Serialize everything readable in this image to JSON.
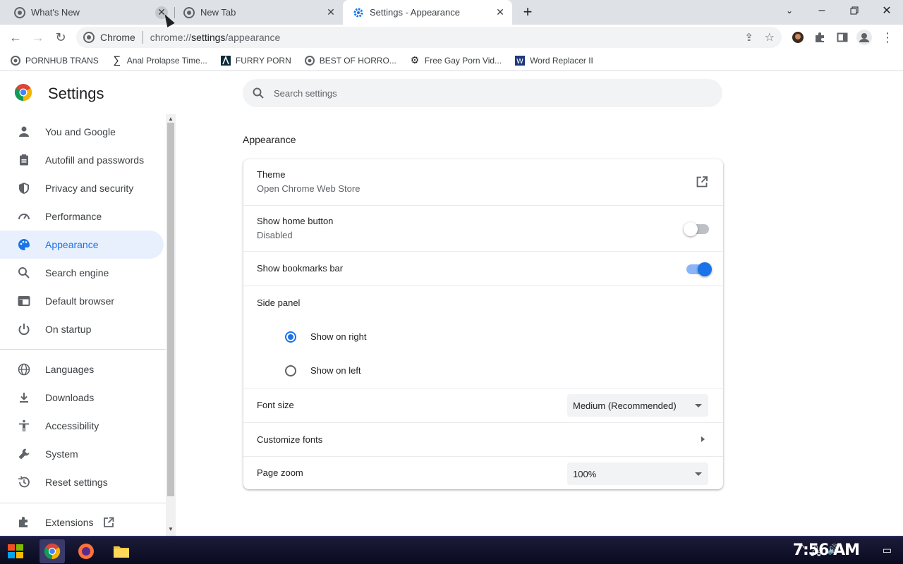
{
  "tabs": [
    {
      "title": "What's New",
      "active": false
    },
    {
      "title": "New Tab",
      "active": false
    },
    {
      "title": "Settings - Appearance",
      "active": true
    }
  ],
  "toolbar": {
    "site_chip": "Chrome",
    "url_host": "chrome://",
    "url_strong": "settings",
    "url_path": "/appearance"
  },
  "bookmarks": [
    {
      "label": "PORNHUB TRANS",
      "icon": "globe-icon"
    },
    {
      "label": "Anal Prolapse Time...",
      "icon": "sigma-icon"
    },
    {
      "label": "FURRY PORN",
      "icon": "a-logo-icon"
    },
    {
      "label": "BEST OF HORRO...",
      "icon": "globe-icon"
    },
    {
      "label": "Free Gay Porn Vid...",
      "icon": "gear-face-icon"
    },
    {
      "label": "Word Replacer II",
      "icon": "w-logo-icon"
    }
  ],
  "settings": {
    "title": "Settings",
    "search_placeholder": "Search settings",
    "nav": [
      {
        "label": "You and Google",
        "icon": "person-icon"
      },
      {
        "label": "Autofill and passwords",
        "icon": "clipboard-icon"
      },
      {
        "label": "Privacy and security",
        "icon": "shield-icon"
      },
      {
        "label": "Performance",
        "icon": "speedometer-icon"
      },
      {
        "label": "Appearance",
        "icon": "palette-icon",
        "selected": true
      },
      {
        "label": "Search engine",
        "icon": "search-icon"
      },
      {
        "label": "Default browser",
        "icon": "browser-icon"
      },
      {
        "label": "On startup",
        "icon": "power-icon"
      },
      {
        "label": "Languages",
        "icon": "globe-icon"
      },
      {
        "label": "Downloads",
        "icon": "download-icon"
      },
      {
        "label": "Accessibility",
        "icon": "accessibility-icon"
      },
      {
        "label": "System",
        "icon": "wrench-icon"
      },
      {
        "label": "Reset settings",
        "icon": "history-icon"
      },
      {
        "label": "Extensions",
        "icon": "puzzle-icon"
      }
    ]
  },
  "appearance": {
    "section_title": "Appearance",
    "theme_label": "Theme",
    "theme_sub": "Open Chrome Web Store",
    "home_label": "Show home button",
    "home_sub": "Disabled",
    "home_enabled": false,
    "bookmarks_label": "Show bookmarks bar",
    "bookmarks_enabled": true,
    "side_panel_label": "Side panel",
    "side_right": "Show on right",
    "side_left": "Show on left",
    "side_selected": "right",
    "font_size_label": "Font size",
    "font_size_value": "Medium (Recommended)",
    "customize_fonts_label": "Customize fonts",
    "page_zoom_label": "Page zoom",
    "page_zoom_value": "100%"
  },
  "taskbar": {
    "clock": "7:56 AM"
  },
  "colors": {
    "accent": "#1a73e8",
    "selected_bg": "#e8f0fe",
    "tabstrip_bg": "#dee1e6"
  }
}
